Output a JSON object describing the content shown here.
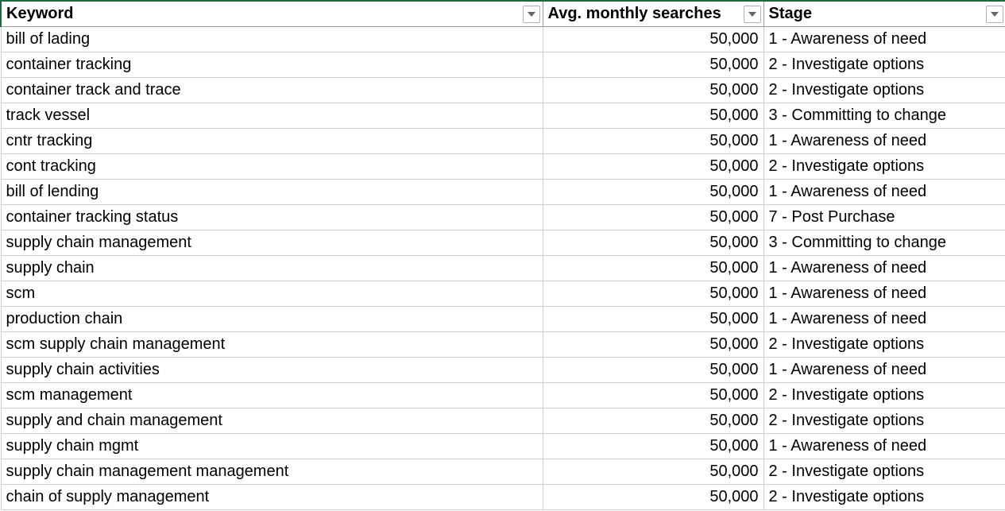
{
  "headers": {
    "keyword": "Keyword",
    "searches": "Avg. monthly searches",
    "stage": "Stage"
  },
  "rows": [
    {
      "keyword": "bill of lading",
      "searches": "50,000",
      "stage": "1 - Awareness of need"
    },
    {
      "keyword": "container tracking",
      "searches": "50,000",
      "stage": "2 - Investigate options"
    },
    {
      "keyword": "container track and trace",
      "searches": "50,000",
      "stage": "2 - Investigate options"
    },
    {
      "keyword": "track vessel",
      "searches": "50,000",
      "stage": "3 - Committing to change"
    },
    {
      "keyword": "cntr tracking",
      "searches": "50,000",
      "stage": "1 - Awareness of need"
    },
    {
      "keyword": "cont tracking",
      "searches": "50,000",
      "stage": "2 - Investigate options"
    },
    {
      "keyword": "bill of lending",
      "searches": "50,000",
      "stage": "1 - Awareness of need"
    },
    {
      "keyword": "container tracking status",
      "searches": "50,000",
      "stage": "7 - Post Purchase"
    },
    {
      "keyword": "supply chain management",
      "searches": "50,000",
      "stage": "3 - Committing to change"
    },
    {
      "keyword": "supply chain",
      "searches": "50,000",
      "stage": "1 - Awareness of need"
    },
    {
      "keyword": "scm",
      "searches": "50,000",
      "stage": "1 - Awareness of need"
    },
    {
      "keyword": "production chain",
      "searches": "50,000",
      "stage": "1 - Awareness of need"
    },
    {
      "keyword": "scm supply chain management",
      "searches": "50,000",
      "stage": "2 - Investigate options"
    },
    {
      "keyword": "supply chain activities",
      "searches": "50,000",
      "stage": "1 - Awareness of need"
    },
    {
      "keyword": "scm management",
      "searches": "50,000",
      "stage": "2 - Investigate options"
    },
    {
      "keyword": "supply and chain management",
      "searches": "50,000",
      "stage": "2 - Investigate options"
    },
    {
      "keyword": "supply chain mgmt",
      "searches": "50,000",
      "stage": "1 - Awareness of need"
    },
    {
      "keyword": "supply chain management management",
      "searches": "50,000",
      "stage": "2 - Investigate options"
    },
    {
      "keyword": "chain of supply management",
      "searches": "50,000",
      "stage": "2 - Investigate options"
    }
  ]
}
